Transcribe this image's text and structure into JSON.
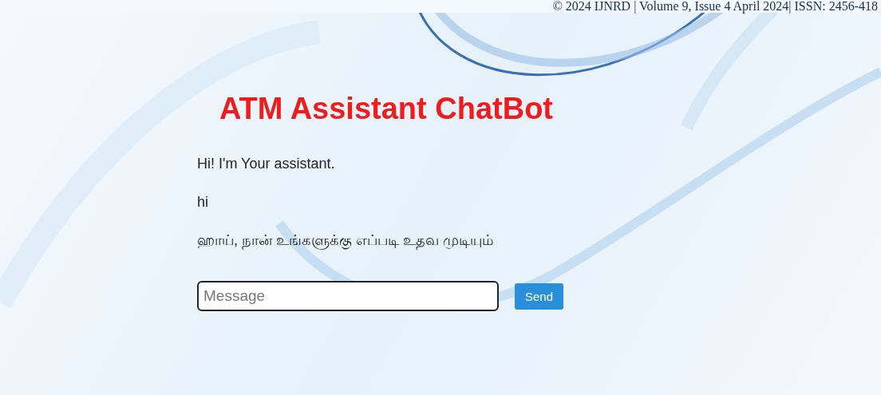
{
  "document_header": "© 2024 IJNRD | Volume 9, Issue 4 April 2024| ISSN: 2456-418",
  "title": "ATM Assistant ChatBot",
  "messages": [
    "Hi! I'm Your assistant.",
    "hi",
    "ஹாய், நான் உங்களுக்கு எப்படி உதவ முடியும்"
  ],
  "composer": {
    "placeholder": "Message",
    "send_label": "Send"
  }
}
